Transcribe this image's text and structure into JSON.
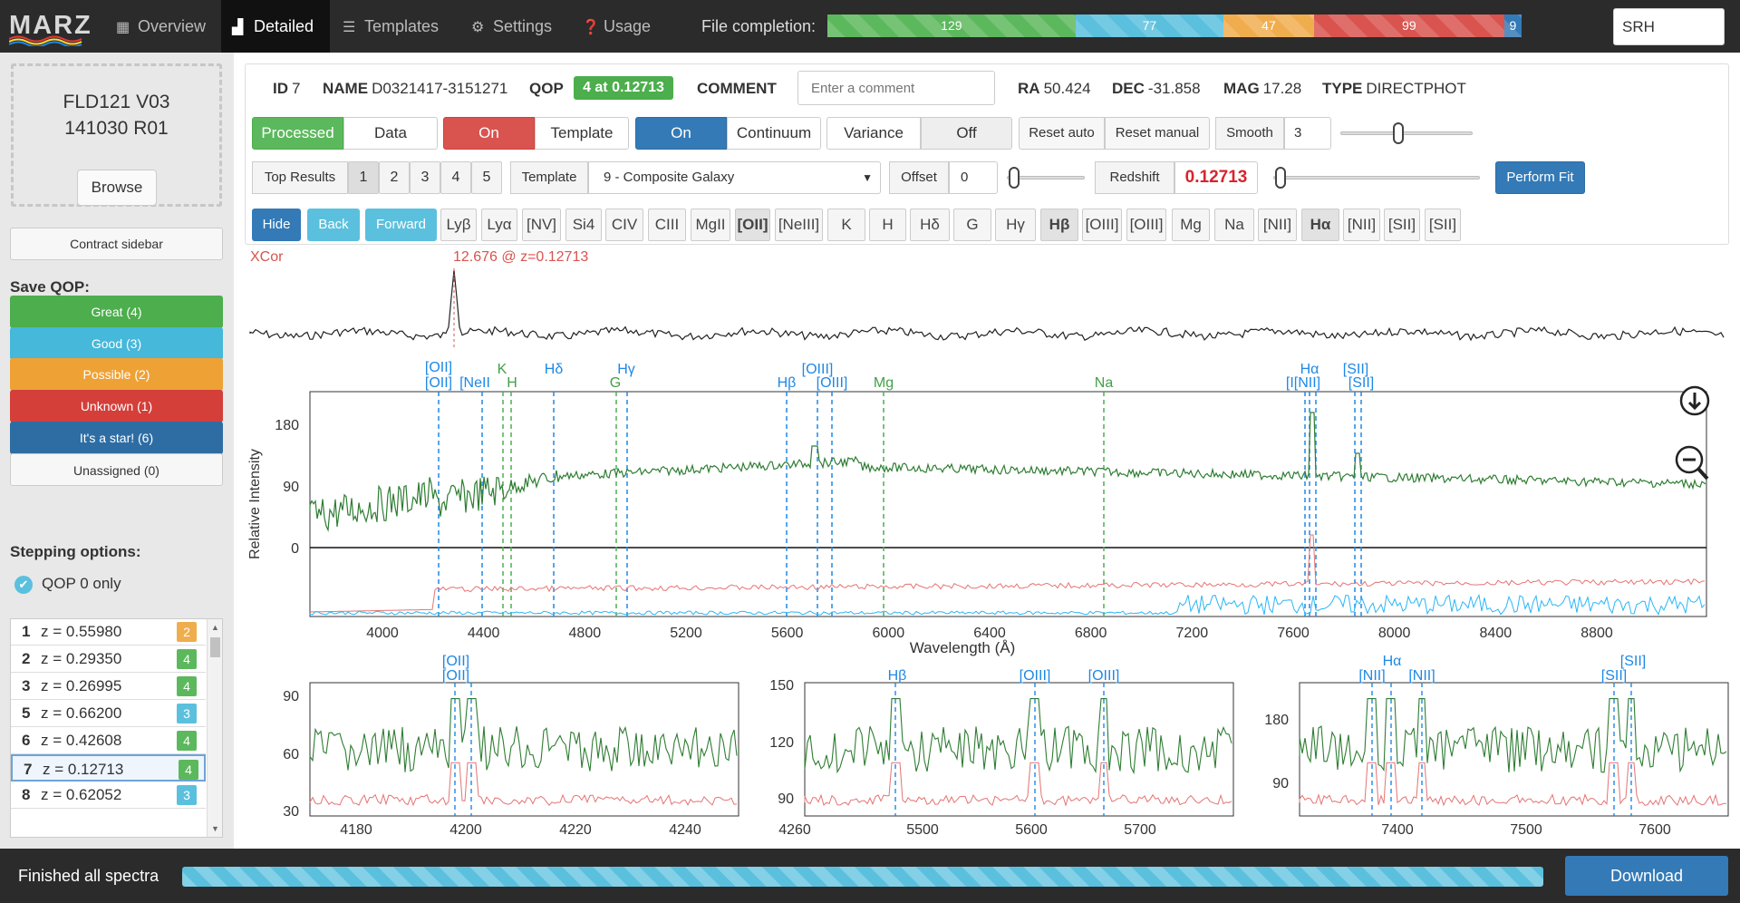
{
  "app": {
    "logo": "MARZ"
  },
  "nav": {
    "overview": "Overview",
    "detailed": "Detailed",
    "templates": "Templates",
    "settings": "Settings",
    "usage": "Usage"
  },
  "file_completion": {
    "label": "File completion:",
    "segments": [
      {
        "value": "129",
        "count": 129,
        "color": "#5cb85c"
      },
      {
        "value": "77",
        "count": 77,
        "color": "#5bc0de"
      },
      {
        "value": "47",
        "count": 47,
        "color": "#f0ad4e"
      },
      {
        "value": "99",
        "count": 99,
        "color": "#d9534f"
      },
      {
        "value": "9",
        "count": 9,
        "color": "#337ab7"
      }
    ]
  },
  "search": {
    "value": "SRH"
  },
  "sidebar": {
    "file_line1": "FLD121 V03",
    "file_line2": "141030 R01",
    "browse": "Browse",
    "contract": "Contract sidebar",
    "save_qop_title": "Save QOP:",
    "qop_buttons": [
      {
        "label": "Great (4)",
        "color": "#4cae4c"
      },
      {
        "label": "Good (3)",
        "color": "#46b8da"
      },
      {
        "label": "Possible (2)",
        "color": "#eea236"
      },
      {
        "label": "Unknown (1)",
        "color": "#d43f3a"
      },
      {
        "label": "It's a star! (6)",
        "color": "#2e6da4"
      },
      {
        "label": "Unassigned (0)",
        "color": "#f7f7f7"
      }
    ],
    "stepping_title": "Stepping options:",
    "qop0_only": "QOP 0 only",
    "results": [
      {
        "n": "1",
        "z": "z = 0.55980",
        "q": "2",
        "color": "#f0ad4e"
      },
      {
        "n": "2",
        "z": "z = 0.29350",
        "q": "4",
        "color": "#5cb85c"
      },
      {
        "n": "3",
        "z": "z = 0.26995",
        "q": "4",
        "color": "#5cb85c"
      },
      {
        "n": "5",
        "z": "z = 0.66200",
        "q": "3",
        "color": "#5bc0de"
      },
      {
        "n": "6",
        "z": "z = 0.42608",
        "q": "4",
        "color": "#5cb85c"
      },
      {
        "n": "7",
        "z": "z = 0.12713",
        "q": "4",
        "color": "#5cb85c"
      },
      {
        "n": "8",
        "z": "z = 0.62052",
        "q": "3",
        "color": "#5bc0de"
      }
    ]
  },
  "detail": {
    "id_label": "ID",
    "id": "7",
    "name_label": "NAME",
    "name": "D0321417-3151271",
    "qop_label": "QOP",
    "qop_badge": "4 at 0.12713",
    "comment_label": "COMMENT",
    "comment_placeholder": "Enter a comment",
    "ra_label": "RA",
    "ra": "50.424",
    "dec_label": "DEC",
    "dec": "-31.858",
    "mag_label": "MAG",
    "mag": "17.28",
    "type_label": "TYPE",
    "type": "DIRECTPHOT"
  },
  "controls": {
    "processed": "Processed",
    "data": "Data",
    "on1": "On",
    "template": "Template",
    "on2": "On",
    "continuum": "Continuum",
    "variance": "Variance",
    "off": "Off",
    "reset_auto": "Reset auto",
    "reset_manual": "Reset manual",
    "smooth_label": "Smooth",
    "smooth_value": "3",
    "top_results_label": "Top Results",
    "top_results": [
      "1",
      "2",
      "3",
      "4",
      "5"
    ],
    "template_label": "Template",
    "template_value": "9 - Composite Galaxy",
    "offset_label": "Offset",
    "offset_value": "0",
    "redshift_label": "Redshift",
    "redshift_value": "0.12713",
    "perform_fit": "Perform Fit",
    "hide": "Hide",
    "back": "Back",
    "forward": "Forward",
    "lines": [
      "Lyβ",
      "Lyα",
      "[NV]",
      "Si4",
      "CIV",
      "CIII",
      "MgII",
      "[OII]",
      "[NeIII]",
      "K",
      "H",
      "Hδ",
      "G",
      "Hγ",
      "Hβ",
      "[OIII]",
      "[OIII]",
      "Mg",
      "Na",
      "[NII]",
      "Hα",
      "[NII]",
      "[SII]",
      "[SII]"
    ],
    "bold_lines": [
      7,
      14,
      20
    ]
  },
  "xcor": {
    "label": "XCor",
    "peak_label": "12.676 @ z=0.12713"
  },
  "main_chart": {
    "ylabel": "Relative Intensity",
    "xlabel": "Wavelength (Å)",
    "yticks": [
      "180",
      "90",
      "0"
    ],
    "xticks": [
      "4000",
      "4400",
      "4800",
      "5200",
      "5600",
      "6000",
      "6400",
      "6800",
      "7200",
      "7600",
      "8000",
      "8400",
      "8800"
    ],
    "line_labels_blue": [
      "[OII]",
      "[OII]",
      "[NeII",
      "Hδ",
      "Hγ",
      "[OIII]",
      "Hβ",
      "[OIII]",
      "Hα",
      "[I[NII]",
      "[SII]",
      "[SII]"
    ],
    "line_labels_green": [
      "K",
      "H",
      "G",
      "Mg",
      "Na"
    ]
  },
  "zoom1": {
    "yticks": [
      "90",
      "60",
      "30"
    ],
    "xticks": [
      "4180",
      "4200",
      "4220",
      "4240",
      "4260"
    ],
    "labels": [
      "[OII]",
      "[OII]"
    ]
  },
  "zoom2": {
    "yticks": [
      "150",
      "120",
      "90"
    ],
    "xticks": [
      "5500",
      "5600",
      "5700"
    ],
    "labels": [
      "Hβ",
      "[OIII]",
      "[OIII]"
    ]
  },
  "zoom3": {
    "yticks": [
      "180",
      "90"
    ],
    "xticks": [
      "7400",
      "7500",
      "7600"
    ],
    "labels": [
      "Hα",
      "[NII]",
      "[NII]",
      "[SII]",
      "[SII]"
    ]
  },
  "footer": {
    "status": "Finished all spectra",
    "download": "Download"
  }
}
